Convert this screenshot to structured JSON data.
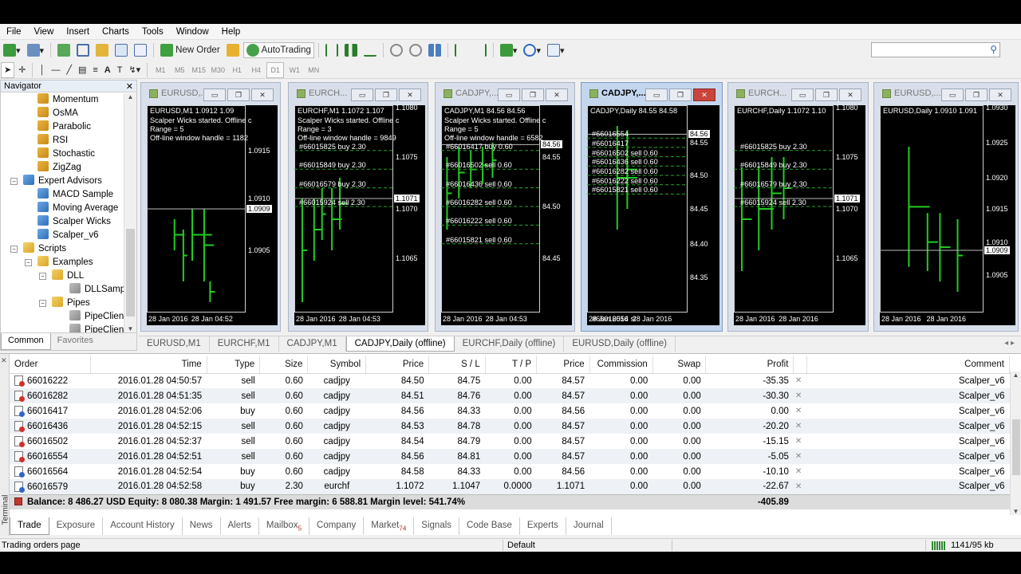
{
  "menu": [
    "File",
    "View",
    "Insert",
    "Charts",
    "Tools",
    "Window",
    "Help"
  ],
  "toolbar": {
    "new_order": "New Order",
    "autotrading": "AutoTrading",
    "timeframes": [
      "M1",
      "M5",
      "M15",
      "M30",
      "H1",
      "H4",
      "D1",
      "W1",
      "MN"
    ],
    "active_timeframe": "D1"
  },
  "navigator": {
    "title": "Navigator",
    "items": [
      {
        "label": "Momentum",
        "icon": "indicator-icon",
        "level": 3
      },
      {
        "label": "OsMA",
        "icon": "indicator-icon",
        "level": 3
      },
      {
        "label": "Parabolic",
        "icon": "indicator-icon",
        "level": 3
      },
      {
        "label": "RSI",
        "icon": "indicator-icon",
        "level": 3
      },
      {
        "label": "Stochastic",
        "icon": "indicator-icon",
        "level": 3
      },
      {
        "label": "ZigZag",
        "icon": "indicator-icon",
        "level": 3
      },
      {
        "label": "Expert Advisors",
        "icon": "expert-advisors-icon",
        "level": 1,
        "expander": "−"
      },
      {
        "label": "MACD Sample",
        "icon": "expert-icon",
        "level": 3
      },
      {
        "label": "Moving Average",
        "icon": "expert-icon",
        "level": 3
      },
      {
        "label": "Scalper Wicks",
        "icon": "expert-icon",
        "level": 3
      },
      {
        "label": "Scalper_v6",
        "icon": "expert-icon",
        "level": 3
      },
      {
        "label": "Scripts",
        "icon": "scripts-icon",
        "level": 1,
        "expander": "−"
      },
      {
        "label": "Examples",
        "icon": "folder-icon",
        "level": 2,
        "expander": "−"
      },
      {
        "label": "DLL",
        "icon": "folder-icon",
        "level": 3,
        "expander": "−"
      },
      {
        "label": "DLLSamp",
        "icon": "script-icon",
        "level": 4
      },
      {
        "label": "Pipes",
        "icon": "folder-icon",
        "level": 3,
        "expander": "−"
      },
      {
        "label": "PipeClien",
        "icon": "script-icon",
        "level": 4
      },
      {
        "label": "PipeClien",
        "icon": "script-icon",
        "level": 4
      }
    ],
    "tabs": [
      "Common",
      "Favorites"
    ],
    "active_tab": "Common"
  },
  "charts": [
    {
      "title": "EURUSD,...",
      "header": "EURUSD,M1  1.0912 1.09",
      "lines": [
        "Scalper Wicks started. Offline c",
        "Range = 5",
        "Off-line window handle = 1182"
      ],
      "orders": [],
      "prices": [
        {
          "v": "1.0915",
          "y": 0.22
        },
        {
          "v": "1.0910",
          "y": 0.45
        },
        {
          "v": "1.0905",
          "y": 0.7
        }
      ],
      "price_box": {
        "v": "1.0909",
        "y": 0.5
      },
      "dates": [
        "28 Jan 2016",
        "28 Jan 04:52"
      ]
    },
    {
      "title": "EURCH...",
      "header": "EURCHF,M1  1.1072 1.107",
      "lines": [
        "Scalper Wicks started. Offline c",
        "Range = 3",
        "Off-line window handle = 9849"
      ],
      "orders": [
        "#66015825 buy 2.30",
        "#66015849 buy 2.30",
        "#66016579 buy 2.30",
        "#66015924 sell 2.30"
      ],
      "prices": [
        {
          "v": "1.1080",
          "y": 0.01
        },
        {
          "v": "1.1075",
          "y": 0.25
        },
        {
          "v": "1.1070",
          "y": 0.5
        },
        {
          "v": "1.1065",
          "y": 0.74
        }
      ],
      "price_box": {
        "v": "1.1071",
        "y": 0.45
      },
      "dates": [
        "28 Jan 2016",
        "28 Jan 04:53"
      ]
    },
    {
      "title": "CADJPY,...",
      "header": "CADJPY,M1  84.56 84.56",
      "lines": [
        "Scalper Wicks started. Offline c",
        "Range = 5",
        "Off-line window handle = 6582"
      ],
      "orders": [
        "#66016417 buy 0.60",
        "#66016502 sell 0.60",
        "#66016436 sell 0.60",
        "#66016282 sell 0.60",
        "#66016222 sell 0.60",
        "#66015821 sell 0.60"
      ],
      "prices": [
        {
          "v": "84.55",
          "y": 0.25
        },
        {
          "v": "84.50",
          "y": 0.49
        },
        {
          "v": "84.45",
          "y": 0.74
        }
      ],
      "price_box": {
        "v": "84.56",
        "y": 0.19
      },
      "dates": [
        "28 Jan 2016",
        "28 Jan 04:53"
      ]
    },
    {
      "title": "CADJPY,...",
      "header": "CADJPY,Daily  84.55 84.58",
      "lines": [],
      "orders": [
        "#66016554",
        "#66016417",
        "#66016502 sell 0.60",
        "#66016436 sell 0.60",
        "#66016282 sell 0.60",
        "#66016222 sell 0.60",
        "#66015821 sell 0.60",
        "#66016554 sl"
      ],
      "prices": [
        {
          "v": "84.55",
          "y": 0.18
        },
        {
          "v": "84.50",
          "y": 0.34
        },
        {
          "v": "84.45",
          "y": 0.5
        },
        {
          "v": "84.40",
          "y": 0.67
        },
        {
          "v": "84.35",
          "y": 0.83
        }
      ],
      "price_box": {
        "v": "84.56",
        "y": 0.14
      },
      "dates": [
        "28 Jan 2016",
        "28 Jan 2016"
      ]
    },
    {
      "title": "EURCH...",
      "header": "EURCHF,Daily  1.1072 1.10",
      "lines": [],
      "orders": [
        "#66015825 buy 2.30",
        "#66015849 buy 2.30",
        "#66016579 buy 2.30",
        "#66015924 sell 2.30"
      ],
      "prices": [
        {
          "v": "1.1080",
          "y": 0.01
        },
        {
          "v": "1.1075",
          "y": 0.25
        },
        {
          "v": "1.1070",
          "y": 0.5
        },
        {
          "v": "1.1065",
          "y": 0.74
        }
      ],
      "price_box": {
        "v": "1.1071",
        "y": 0.45
      },
      "dates": [
        "28 Jan 2016",
        "28 Jan 2016"
      ]
    },
    {
      "title": "EURUSD,...",
      "header": "EURUSD,Daily  1.0910 1.091",
      "lines": [],
      "orders": [],
      "prices": [
        {
          "v": "1.0930",
          "y": 0.01
        },
        {
          "v": "1.0925",
          "y": 0.18
        },
        {
          "v": "1.0920",
          "y": 0.35
        },
        {
          "v": "1.0915",
          "y": 0.5
        },
        {
          "v": "1.0910",
          "y": 0.66
        },
        {
          "v": "1.0905",
          "y": 0.82
        }
      ],
      "price_box": {
        "v": "1.0909",
        "y": 0.7
      },
      "dates": [
        "28 Jan 2016",
        "28 Jan 2016"
      ]
    }
  ],
  "chart_tabs": [
    "EURUSD,M1",
    "EURCHF,M1",
    "CADJPY,M1",
    "CADJPY,Daily (offline)",
    "EURCHF,Daily (offline)",
    "EURUSD,Daily (offline)"
  ],
  "active_chart_tab": 3,
  "trade": {
    "columns": [
      "Order",
      "Time",
      "Type",
      "Size",
      "Symbol",
      "Price",
      "S / L",
      "T / P",
      "Price",
      "Commission",
      "Swap",
      "Profit",
      "",
      "Comment"
    ],
    "rows": [
      {
        "order": "66016222",
        "time": "2016.01.28 04:50:57",
        "type": "sell",
        "size": "0.60",
        "symbol": "cadjpy",
        "price": "84.50",
        "sl": "84.75",
        "tp": "0.00",
        "cur": "84.57",
        "commission": "0.00",
        "swap": "0.00",
        "profit": "-35.35",
        "comment": "Scalper_v6"
      },
      {
        "order": "66016282",
        "time": "2016.01.28 04:51:35",
        "type": "sell",
        "size": "0.60",
        "symbol": "cadjpy",
        "price": "84.51",
        "sl": "84.76",
        "tp": "0.00",
        "cur": "84.57",
        "commission": "0.00",
        "swap": "0.00",
        "profit": "-30.30",
        "comment": "Scalper_v6"
      },
      {
        "order": "66016417",
        "time": "2016.01.28 04:52:06",
        "type": "buy",
        "size": "0.60",
        "symbol": "cadjpy",
        "price": "84.56",
        "sl": "84.33",
        "tp": "0.00",
        "cur": "84.56",
        "commission": "0.00",
        "swap": "0.00",
        "profit": "0.00",
        "comment": "Scalper_v6"
      },
      {
        "order": "66016436",
        "time": "2016.01.28 04:52:15",
        "type": "sell",
        "size": "0.60",
        "symbol": "cadjpy",
        "price": "84.53",
        "sl": "84.78",
        "tp": "0.00",
        "cur": "84.57",
        "commission": "0.00",
        "swap": "0.00",
        "profit": "-20.20",
        "comment": "Scalper_v6"
      },
      {
        "order": "66016502",
        "time": "2016.01.28 04:52:37",
        "type": "sell",
        "size": "0.60",
        "symbol": "cadjpy",
        "price": "84.54",
        "sl": "84.79",
        "tp": "0.00",
        "cur": "84.57",
        "commission": "0.00",
        "swap": "0.00",
        "profit": "-15.15",
        "comment": "Scalper_v6"
      },
      {
        "order": "66016554",
        "time": "2016.01.28 04:52:51",
        "type": "sell",
        "size": "0.60",
        "symbol": "cadjpy",
        "price": "84.56",
        "sl": "84.81",
        "tp": "0.00",
        "cur": "84.57",
        "commission": "0.00",
        "swap": "0.00",
        "profit": "-5.05",
        "comment": "Scalper_v6"
      },
      {
        "order": "66016564",
        "time": "2016.01.28 04:52:54",
        "type": "buy",
        "size": "0.60",
        "symbol": "cadjpy",
        "price": "84.58",
        "sl": "84.33",
        "tp": "0.00",
        "cur": "84.56",
        "commission": "0.00",
        "swap": "0.00",
        "profit": "-10.10",
        "comment": "Scalper_v6"
      },
      {
        "order": "66016579",
        "time": "2016.01.28 04:52:58",
        "type": "buy",
        "size": "2.30",
        "symbol": "eurchf",
        "price": "1.1072",
        "sl": "1.1047",
        "tp": "0.0000",
        "cur": "1.1071",
        "commission": "0.00",
        "swap": "0.00",
        "profit": "-22.67",
        "comment": "Scalper_v6"
      }
    ],
    "balance_line": "Balance: 8 486.27 USD  Equity: 8 080.38  Margin: 1 491.57  Free margin: 6 588.81  Margin level: 541.74%",
    "total_profit": "-405.89"
  },
  "terminal_tabs": [
    {
      "label": "Trade"
    },
    {
      "label": "Exposure"
    },
    {
      "label": "Account History"
    },
    {
      "label": "News"
    },
    {
      "label": "Alerts"
    },
    {
      "label": "Mailbox",
      "badge": "5"
    },
    {
      "label": "Company"
    },
    {
      "label": "Market",
      "badge": "74"
    },
    {
      "label": "Signals"
    },
    {
      "label": "Code Base"
    },
    {
      "label": "Experts"
    },
    {
      "label": "Journal"
    }
  ],
  "terminal_label": "Terminal",
  "status": {
    "left": "Trading orders page",
    "profile": "Default",
    "traffic": "1141/95 kb"
  }
}
